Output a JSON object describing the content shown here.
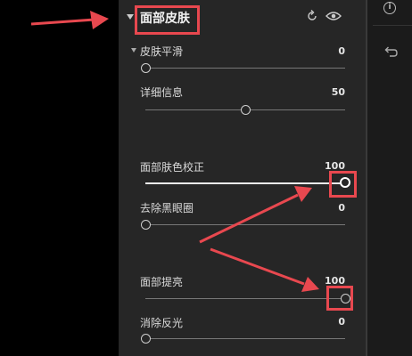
{
  "panel": {
    "title": "面部皮肤",
    "subsection": "皮肤平滑"
  },
  "sliders": [
    {
      "label": "皮肤平滑",
      "value": "0",
      "level": 0
    },
    {
      "label": "详细信息",
      "value": "50",
      "level": 50
    },
    {
      "label": "面部肤色校正",
      "value": "100",
      "level": 100
    },
    {
      "label": "去除黑眼圈",
      "value": "0",
      "level": 0
    },
    {
      "label": "面部提亮",
      "value": "100",
      "level": 100
    },
    {
      "label": "消除反光",
      "value": "0",
      "level": 0
    }
  ],
  "icons": {
    "header_collapse": "triangle-down-icon",
    "reset": "reset-icon",
    "visibility": "eye-icon",
    "info": "info-icon",
    "undo": "undo-icon"
  },
  "info_glyph": "i",
  "colors": {
    "panel_bg": "#262626",
    "annotation_red": "#e8484f",
    "slider_fill": "#eeeeee"
  }
}
